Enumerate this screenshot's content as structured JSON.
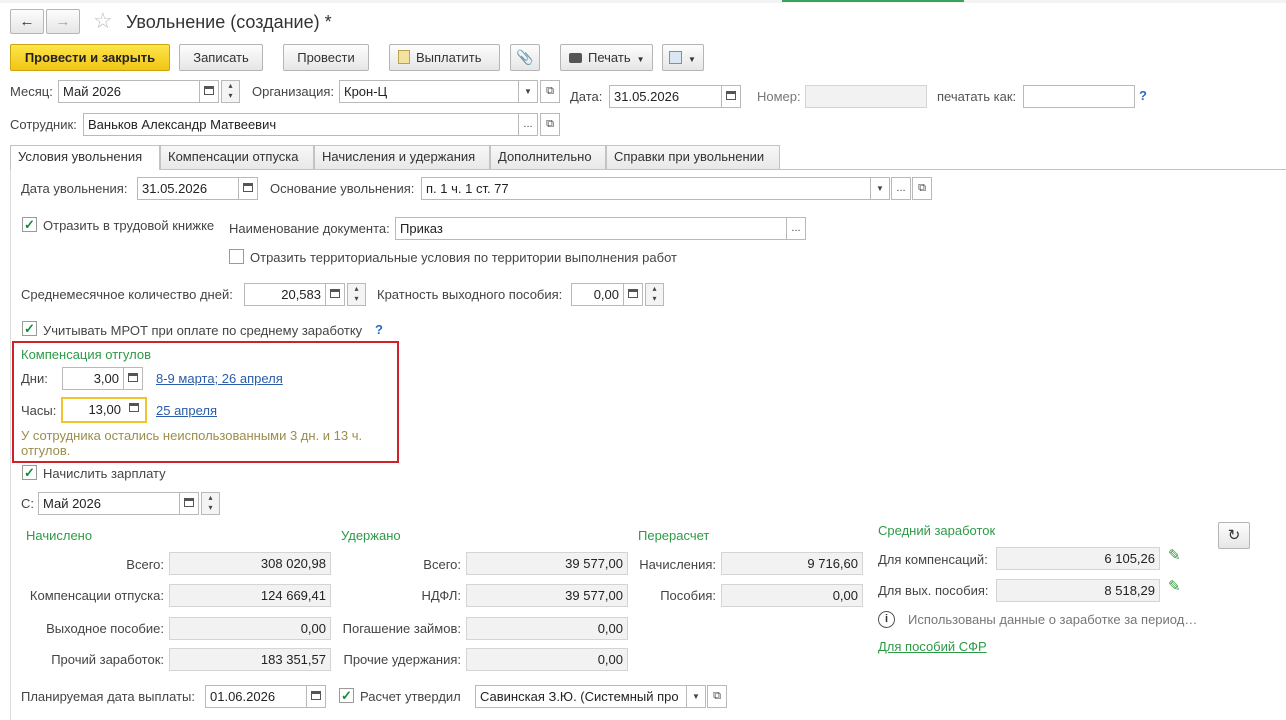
{
  "window": {
    "title": "Увольнение (создание) *"
  },
  "toolbar": {
    "post_close": "Провести и закрыть",
    "save": "Записать",
    "post": "Провести",
    "pay": "Выплатить",
    "print": "Печать"
  },
  "header": {
    "month_label": "Месяц:",
    "month": "Май 2026",
    "org_label": "Организация:",
    "org": "Крон-Ц",
    "date_label": "Дата:",
    "date": "31.05.2026",
    "number_label": "Номер:",
    "number": "",
    "print_as_label": "печатать как:",
    "print_as": "",
    "employee_label": "Сотрудник:",
    "employee": "Ваньков Александр Матвеевич"
  },
  "tabs": [
    {
      "label": "Условия увольнения"
    },
    {
      "label": "Компенсации отпуска"
    },
    {
      "label": "Начисления и удержания"
    },
    {
      "label": "Дополнительно"
    },
    {
      "label": "Справки при увольнении"
    }
  ],
  "conditions": {
    "dismissal_date_label": "Дата увольнения:",
    "dismissal_date": "31.05.2026",
    "reason_label": "Основание увольнения:",
    "reason": "п. 1 ч. 1 ст. 77",
    "workbook_label": "Отразить в трудовой книжке",
    "workbook_checked": true,
    "doc_name_label": "Наименование документа:",
    "doc_name": "Приказ",
    "territorial_label": "Отразить территориальные условия по территории выполнения работ",
    "territorial_checked": false,
    "avg_days_label": "Среднемесячное количество дней:",
    "avg_days": "20,583",
    "severance_mult_label": "Кратность выходного пособия:",
    "severance_mult": "0,00",
    "mrot_label": "Учитывать МРОТ при оплате по среднему заработку",
    "mrot_checked": true
  },
  "compensation": {
    "title": "Компенсация отгулов",
    "days_label": "Дни:",
    "days": "3,00",
    "days_link": "8-9 марта;  26 апреля",
    "hours_label": "Часы:",
    "hours": "13,00",
    "hours_link": "25 апреля",
    "note": "У сотрудника остались неиспользованными 3 дн. и 13 ч. отгулов."
  },
  "salary": {
    "label": "Начислить зарплату",
    "checked": true,
    "from_label": "С:",
    "from": "Май 2026"
  },
  "accrued": {
    "title": "Начислено",
    "rows": [
      {
        "label": "Всего:",
        "value": "308 020,98"
      },
      {
        "label": "Компенсации отпуска:",
        "value": "124 669,41"
      },
      {
        "label": "Выходное пособие:",
        "value": "0,00"
      },
      {
        "label": "Прочий заработок:",
        "value": "183 351,57"
      }
    ]
  },
  "withheld": {
    "title": "Удержано",
    "rows": [
      {
        "label": "Всего:",
        "value": "39 577,00"
      },
      {
        "label": "НДФЛ:",
        "value": "39 577,00"
      },
      {
        "label": "Погашение займов:",
        "value": "0,00"
      },
      {
        "label": "Прочие удержания:",
        "value": "0,00"
      }
    ]
  },
  "recalc": {
    "title": "Перерасчет",
    "rows": [
      {
        "label": "Начисления:",
        "value": "9 716,60"
      },
      {
        "label": "Пособия:",
        "value": "0,00"
      }
    ]
  },
  "avg_earnings": {
    "title": "Средний заработок",
    "comp_label": "Для компенсаций:",
    "comp": "6 105,26",
    "sev_label": "Для вых. пособия:",
    "sev": "8 518,29",
    "info": "Использованы данные о заработке за период…",
    "sfr_link": "Для пособий СФР"
  },
  "footer": {
    "pay_date_label": "Планируемая дата выплаты:",
    "pay_date": "01.06.2026",
    "approved_label": "Расчет утвердил",
    "approved_checked": true,
    "approver": "Савинская З.Ю. (Системный про"
  },
  "colors": {
    "accent_green": "#2e9a48",
    "link_blue": "#2a5ca8",
    "highlight_red": "#d0202a",
    "primary_yellow": "#f6d02a"
  }
}
